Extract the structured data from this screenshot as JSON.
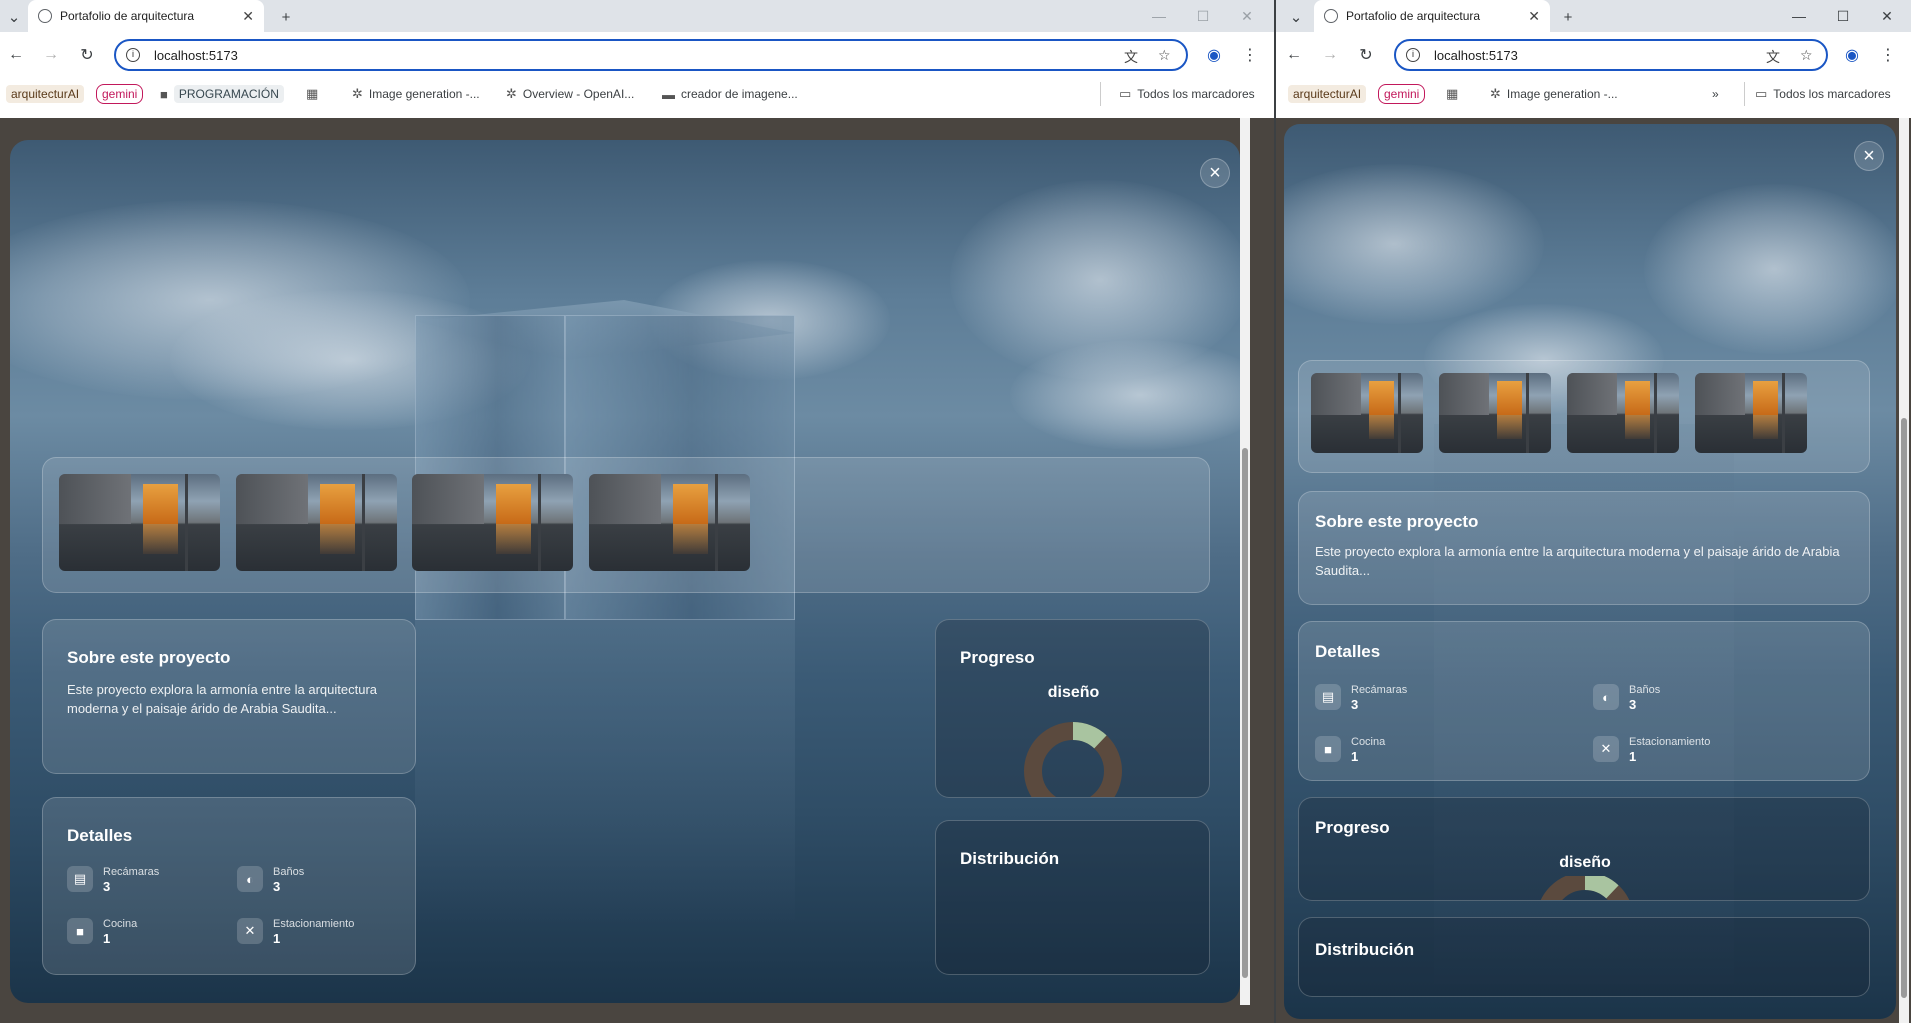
{
  "browser": {
    "tab_title": "Portafolio de arquitectura",
    "url": "localhost:5173",
    "bookmarks_left": [
      "arquitecturAI",
      "gemini",
      "PROGRAMACIÓN",
      "Image generation -...",
      "Overview - OpenAI...",
      "creador de imagene..."
    ],
    "bookmarks_right": [
      "arquitecturAI",
      "gemini",
      "Image generation -..."
    ],
    "all_bookmarks": "Todos los marcadores",
    "overflow": "»"
  },
  "modal": {
    "close": "×",
    "about_title": "Sobre este proyecto",
    "about_text": "Este proyecto explora la armonía entre la arquitectura moderna y el paisaje árido de Arabia Saudita...",
    "details_title": "Detalles",
    "details": [
      {
        "label": "Recámaras",
        "value": "3",
        "icon": "bed-icon"
      },
      {
        "label": "Baños",
        "value": "3",
        "icon": "bath-icon"
      },
      {
        "label": "Cocina",
        "value": "1",
        "icon": "kitchen-icon"
      },
      {
        "label": "Estacionamiento",
        "value": "1",
        "icon": "parking-icon"
      }
    ],
    "progress_title": "Progreso",
    "progress_phase": "diseño",
    "progress_fraction": 0.12,
    "distribution_title": "Distribución",
    "thumbnail_count": 4
  },
  "colors": {
    "accent": "#1a56c4",
    "donut_base": "#5b4a3e",
    "donut_progress": "#a9c4a0"
  }
}
